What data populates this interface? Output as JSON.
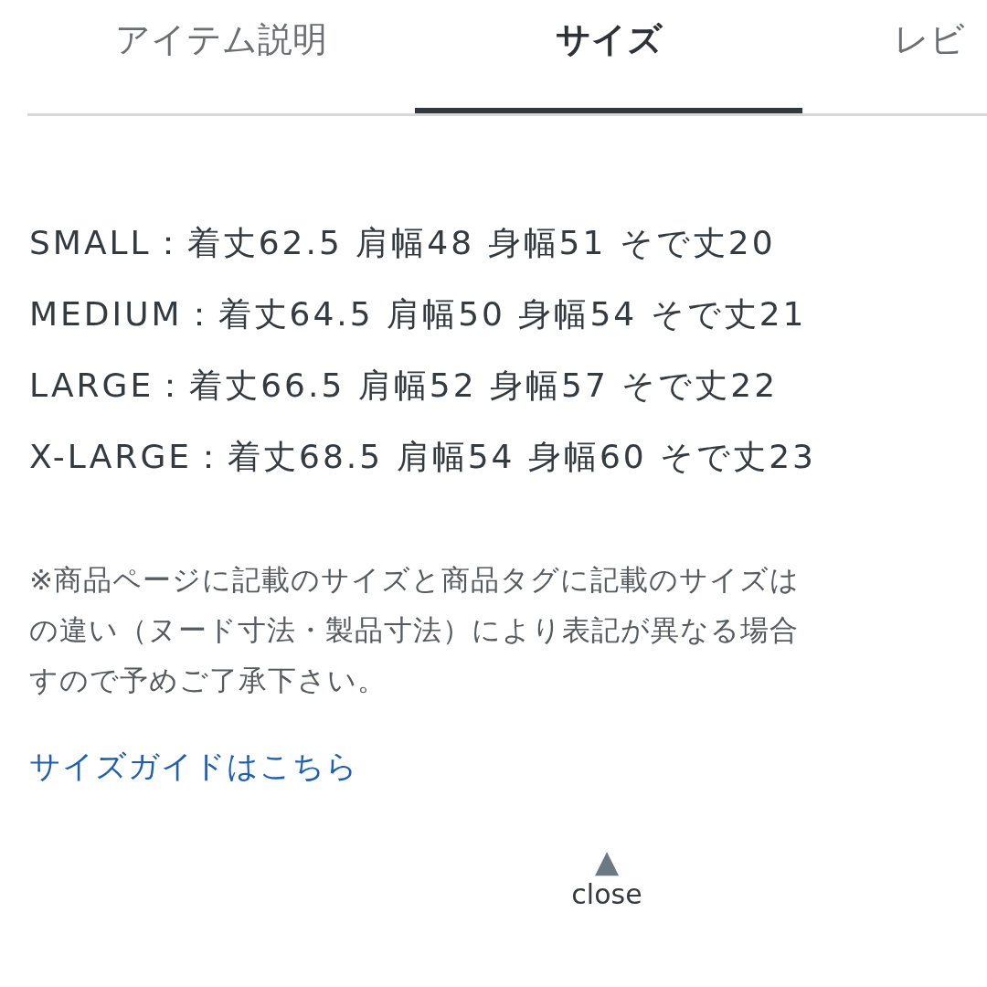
{
  "tabs": [
    {
      "label": "アイテム説明",
      "selected": false
    },
    {
      "label": "サイズ",
      "selected": true
    },
    {
      "label": "レビ",
      "selected": false
    }
  ],
  "sizes": [
    "SMALL：着丈62.5 肩幅48 身幅51 そで丈20",
    "MEDIUM：着丈64.5 肩幅50 身幅54 そで丈21",
    "LARGE：着丈66.5 肩幅52 身幅57 そで丈22",
    "X-LARGE：着丈68.5 肩幅54 身幅60 そで丈23"
  ],
  "note_lines": [
    "※商品ページに記載のサイズと商品タグに記載のサイズは",
    "の違い（ヌード寸法・製品寸法）により表記が異なる場合",
    "すので予めご了承下さい。"
  ],
  "size_guide_link": "サイズガイドはこちら",
  "close": {
    "icon": "▲",
    "label": "close"
  }
}
